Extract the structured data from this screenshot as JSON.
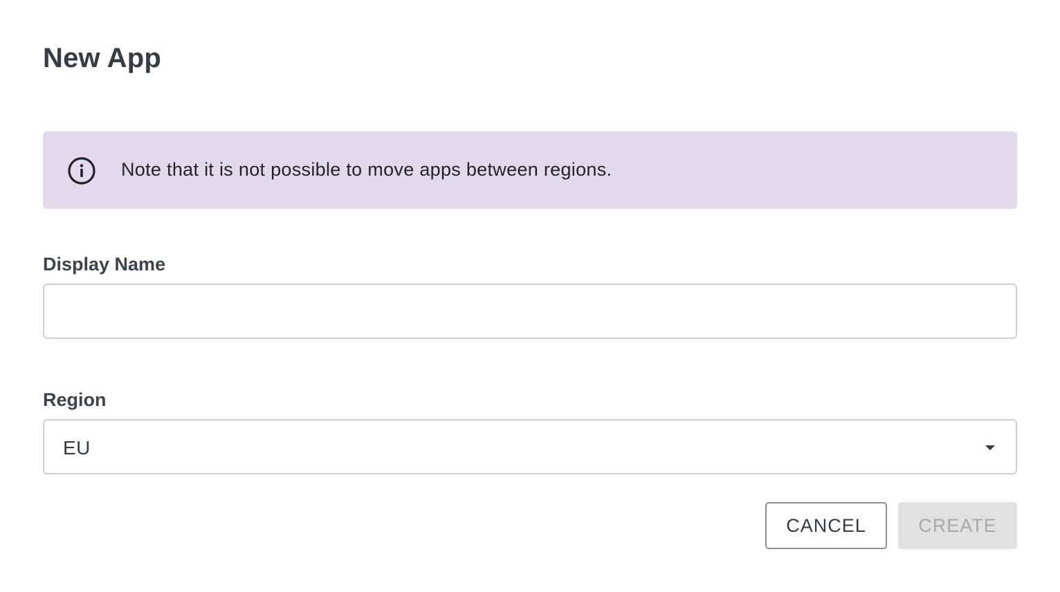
{
  "dialog": {
    "title": "New App"
  },
  "notice": {
    "icon": "info-icon",
    "text": "Note that it is not possible to move apps between regions.",
    "background": "#e4d9ec"
  },
  "fields": {
    "display_name": {
      "label": "Display Name",
      "value": "",
      "placeholder": ""
    },
    "region": {
      "label": "Region",
      "selected": "EU",
      "icon": "caret-down-icon"
    }
  },
  "actions": {
    "cancel_label": "CANCEL",
    "create_label": "CREATE",
    "create_disabled": true
  }
}
